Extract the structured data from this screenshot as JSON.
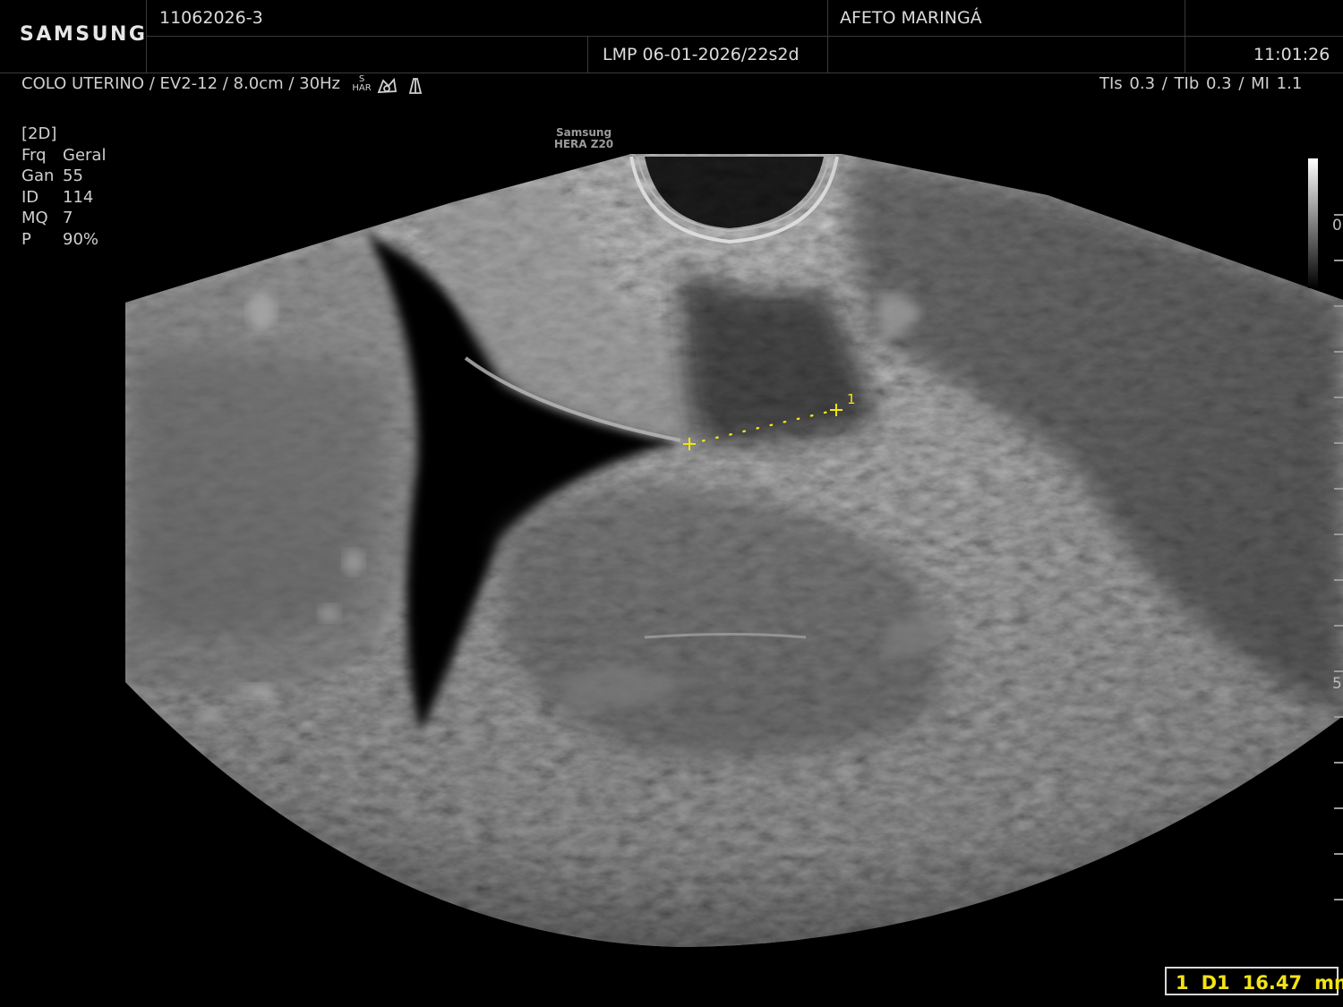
{
  "header": {
    "logo": "SAMSUNG",
    "patient_id": "11062026-3",
    "institution": "AFETO MARINGÁ",
    "lmp": "LMP 06-01-2026/22s2d",
    "time": "11:01:26"
  },
  "exam": {
    "preset_line": "COLO UTERINO / EV2-12 / 8.0cm / 30Hz",
    "har_top": "S",
    "har_bottom": "HAR",
    "thermal_index": "TIs   0.3 / TIb   0.3 / MI     1.1"
  },
  "params": {
    "mode": "[2D]",
    "rows": [
      {
        "key": "Frq",
        "value": "Geral"
      },
      {
        "key": "Gan",
        "value": "55"
      },
      {
        "key": "ID",
        "value": "114"
      },
      {
        "key": "MQ",
        "value": "7"
      },
      {
        "key": "P",
        "value": "90%"
      }
    ]
  },
  "brand": {
    "line1": "Samsung",
    "line2": "HERA Z20"
  },
  "depth_scale": {
    "label_0": "0",
    "label_5": "5"
  },
  "caliper": {
    "marker_label": "1"
  },
  "measurement": {
    "index": "1",
    "name": "D1",
    "value": "16.47",
    "unit": "mm"
  },
  "colors": {
    "caliper": "#f2e316",
    "background": "#000000",
    "text": "#d8d8d8"
  }
}
